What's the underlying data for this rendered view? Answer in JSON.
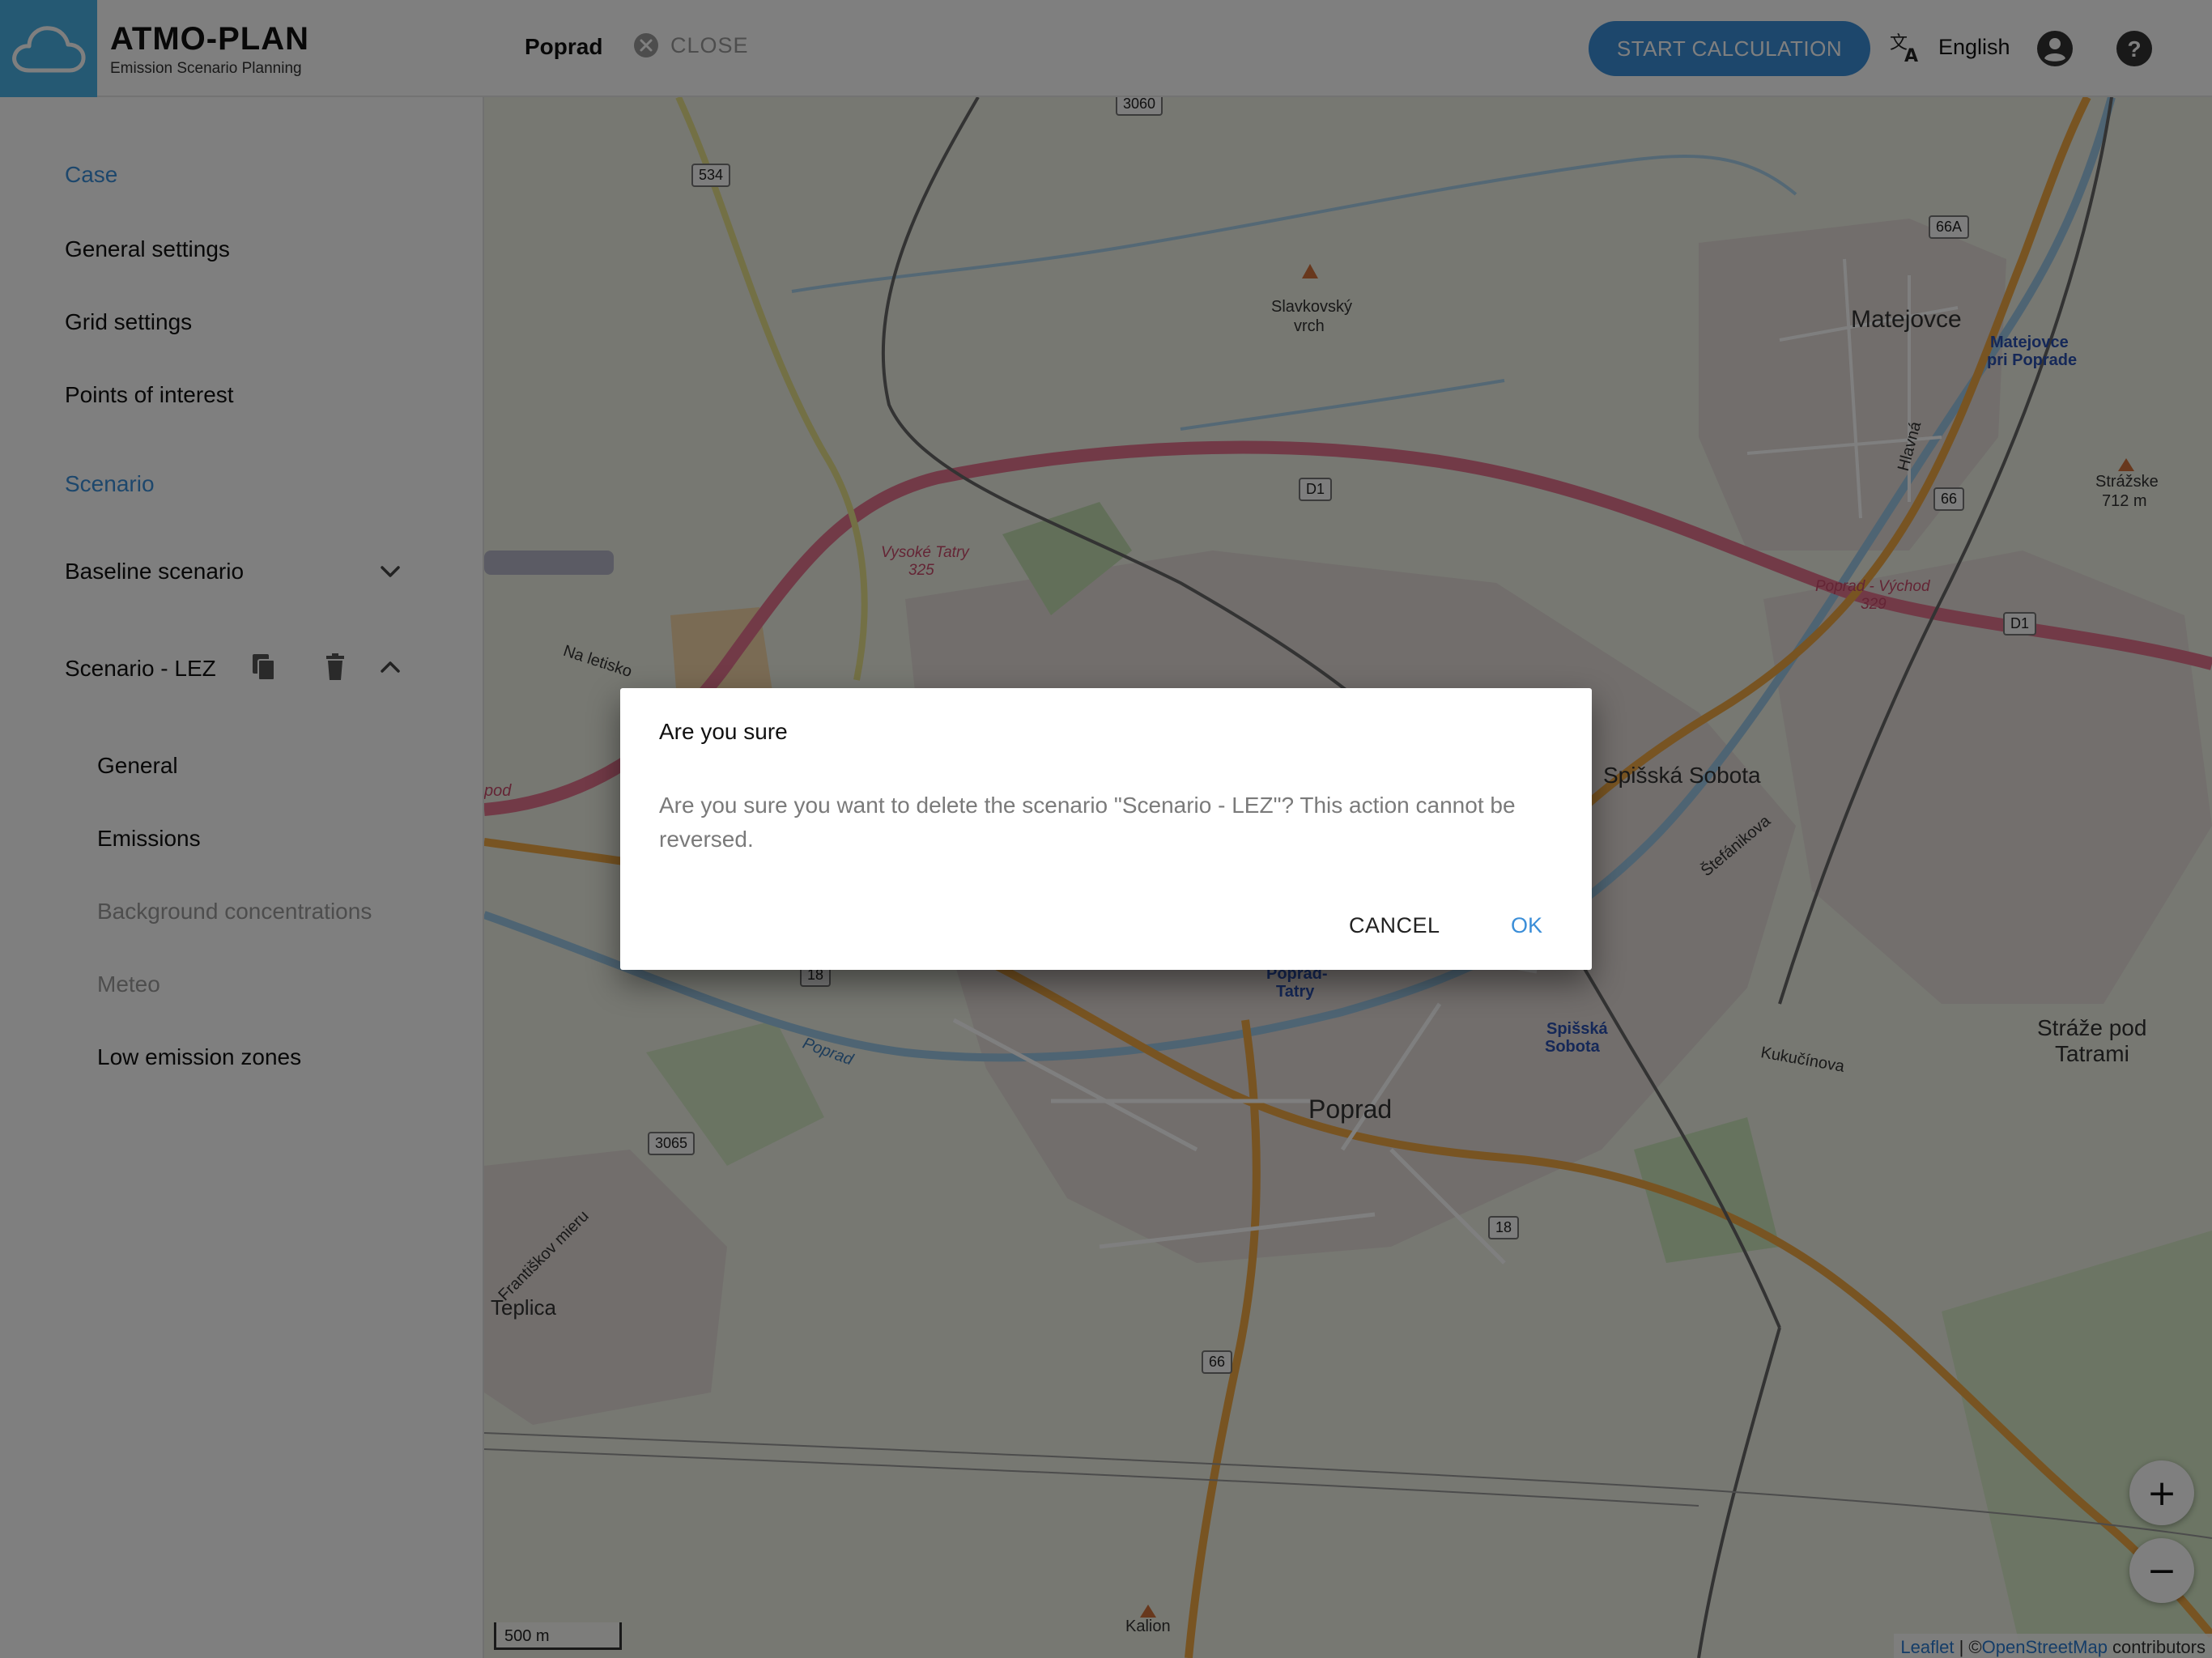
{
  "app": {
    "name": "ATMO-PLAN",
    "subtitle": "Emission Scenario Planning"
  },
  "header": {
    "case_name": "Poprad",
    "close_label": "CLOSE",
    "start_calculation_label": "START CALCULATION",
    "language": "English",
    "icons": [
      "cloud-logo-icon",
      "close-circle-icon",
      "translate-icon",
      "account-icon",
      "help-icon"
    ]
  },
  "sidebar": {
    "case_section": "Case",
    "case_items": [
      "General settings",
      "Grid settings",
      "Points of interest"
    ],
    "scenario_section": "Scenario",
    "scenarios": [
      {
        "label": "Baseline scenario",
        "expanded": false
      },
      {
        "label": "Scenario - LEZ",
        "expanded": true
      }
    ],
    "scenario_items": [
      {
        "label": "General",
        "enabled": true
      },
      {
        "label": "Emissions",
        "enabled": true
      },
      {
        "label": "Background concentrations",
        "enabled": false
      },
      {
        "label": "Meteo",
        "enabled": false
      },
      {
        "label": "Low emission zones",
        "enabled": true
      }
    ]
  },
  "map": {
    "place_labels": {
      "poprad": "Poprad",
      "matejovce": "Matejovce",
      "spisska_sobota": "Spišská Sobota",
      "straze_line1": "Stráže pod",
      "straze_line2": "Tatrami",
      "teplica": "Teplica",
      "slavkovsky_line1": "Slavkovský",
      "slavkovsky_line2": "vrch",
      "strazske_line1": "Strážske",
      "strazske_line2": "712 m",
      "kalion": "Kalion",
      "matejovce_station_line1": "Matejovce",
      "matejovce_station_line2": "pri Poprade",
      "poprad_tatry_station_line1": "Poprad-",
      "poprad_tatry_station_line2": "Tatry",
      "spisska_sobota_station_line1": "Spišská",
      "spisska_sobota_station_line2": "Sobota",
      "vysoke_tatry_line1": "Vysoké Tatry",
      "vysoke_tatry_line2": "325",
      "poprad_vychod_line1": "Poprad - Východ",
      "poprad_vychod_line2": "329",
      "na_letisko": "Na letisko",
      "stefanikova": "Štefánikova",
      "kukucinova": "Kukučínova",
      "hlavna": "Hlavná",
      "francov_mieru": "Františkov mieru",
      "poprad_river": "Poprad",
      "pod": "pod"
    },
    "road_shields": {
      "r3060": "3060",
      "r534": "534",
      "r66a": "66A",
      "r66_top": "66",
      "d1_center": "D1",
      "d1_right": "D1",
      "r18_left": "18",
      "r18_right": "18",
      "r3065": "3065",
      "r66_bottom": "66"
    },
    "zoom_in": "+",
    "zoom_out": "−",
    "scale": "500 m",
    "attribution_leaflet": "Leaflet",
    "attribution_sep": " | ©",
    "attribution_osm": "OpenStreetMap",
    "attribution_tail": " contributors"
  },
  "dialog": {
    "title": "Are you sure",
    "message": "Are you sure you want to delete the scenario \"Scenario - LEZ\"? This action cannot be reversed.",
    "cancel_label": "CANCEL",
    "ok_label": "OK"
  },
  "colors": {
    "accent": "#3b8ed8",
    "logo_bg": "#4bb3e6",
    "motorway": "#e4748f",
    "primary_road": "#f0a845",
    "overlay": "rgba(0,0,0,0.5)"
  }
}
